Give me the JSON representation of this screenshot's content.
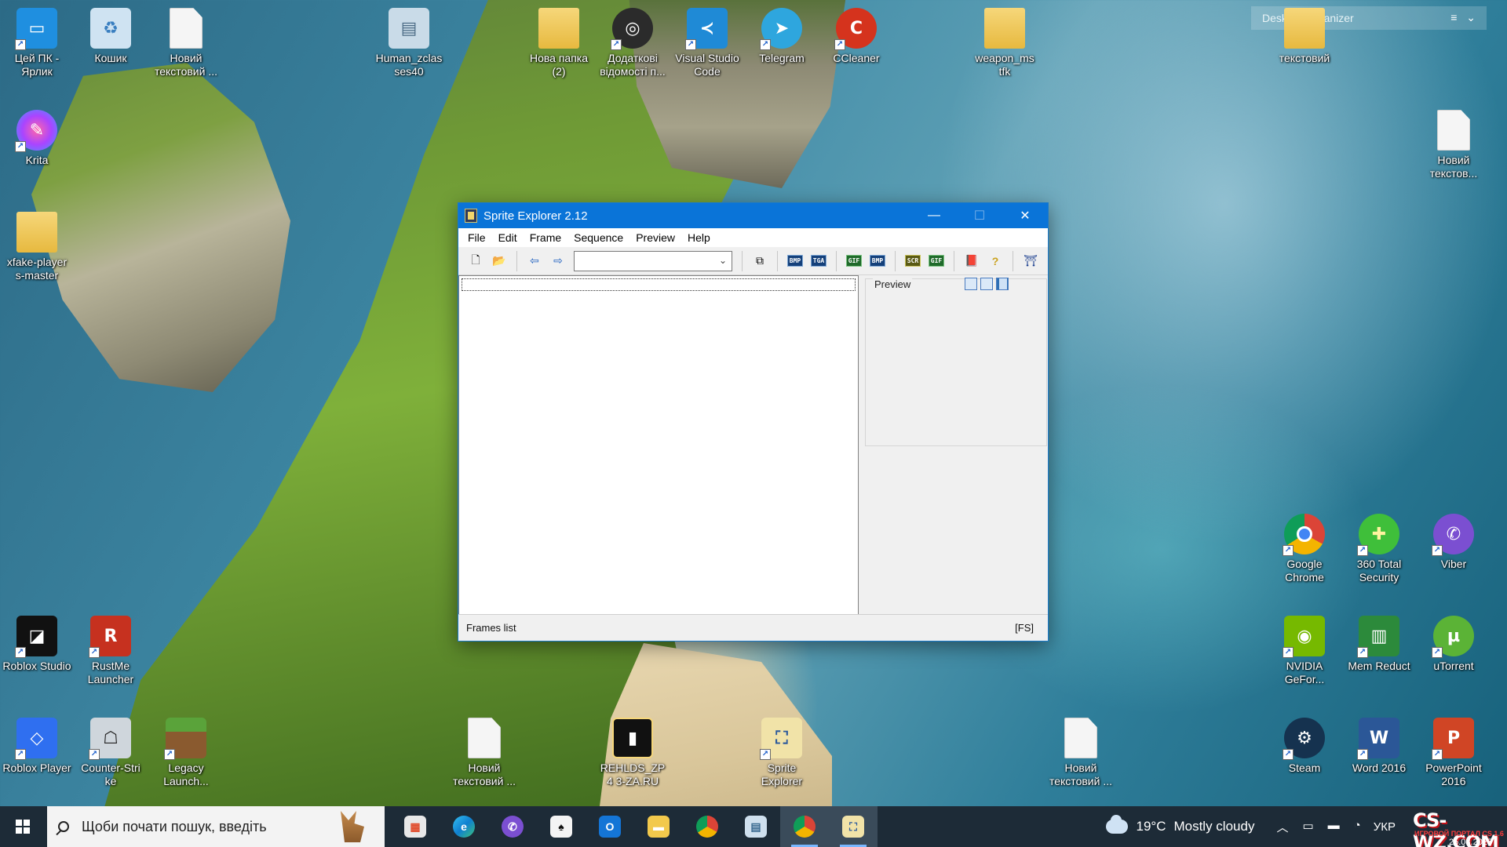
{
  "colors": {
    "titlebar": "#0a74d8",
    "taskbar": "#1d2b37",
    "window_bg": "#f0f0f0"
  },
  "desktop": {
    "organizer_title": "Desktop Organizer",
    "icons": [
      {
        "label": "Цей ПК - Ярлик",
        "icon": "this-pc-icon"
      },
      {
        "label": "Кошик",
        "icon": "recycle-bin-icon"
      },
      {
        "label": "Новий текстовий ...",
        "icon": "text-document-icon"
      },
      {
        "label": "Human_zclas ses40",
        "icon": "document-icon"
      },
      {
        "label": "Нова папка (2)",
        "icon": "folder-icon"
      },
      {
        "label": "Додаткові відомості п...",
        "icon": "info-icon"
      },
      {
        "label": "Visual Studio Code",
        "icon": "vscode-icon"
      },
      {
        "label": "Telegram",
        "icon": "telegram-icon"
      },
      {
        "label": "CCleaner",
        "icon": "ccleaner-icon"
      },
      {
        "label": "weapon_ms tfk",
        "icon": "folder-icon"
      },
      {
        "label": "текстовий",
        "icon": "folder-icon"
      },
      {
        "label": "Krita",
        "icon": "krita-icon"
      },
      {
        "label": "Новий текстов...",
        "icon": "text-document-icon"
      },
      {
        "label": "xfake-player s-master",
        "icon": "folder-icon"
      },
      {
        "label": "Google Chrome",
        "icon": "chrome-icon"
      },
      {
        "label": "360 Total Security",
        "icon": "360-security-icon"
      },
      {
        "label": "Viber",
        "icon": "viber-icon"
      },
      {
        "label": "Roblox Studio",
        "icon": "roblox-studio-icon"
      },
      {
        "label": "RustMe Launcher",
        "icon": "rustme-icon"
      },
      {
        "label": "NVIDIA GeFor...",
        "icon": "nvidia-icon"
      },
      {
        "label": "Mem Reduct",
        "icon": "mem-reduct-icon"
      },
      {
        "label": "uTorrent",
        "icon": "utorrent-icon"
      },
      {
        "label": "Roblox Player",
        "icon": "roblox-player-icon"
      },
      {
        "label": "Counter-Stri ke",
        "icon": "counter-strike-icon"
      },
      {
        "label": "Legacy Launch...",
        "icon": "minecraft-icon"
      },
      {
        "label": "Новий текстовий ...",
        "icon": "text-document-icon"
      },
      {
        "label": "REHLDS_ZP4 3-ZA.RU",
        "icon": "zip-folder-icon"
      },
      {
        "label": "Sprite Explorer",
        "icon": "sprite-explorer-icon"
      },
      {
        "label": "Новий текстовий ...",
        "icon": "text-document-icon"
      },
      {
        "label": "Steam",
        "icon": "steam-icon"
      },
      {
        "label": "Word 2016",
        "icon": "word-icon"
      },
      {
        "label": "PowerPoint 2016",
        "icon": "powerpoint-icon"
      }
    ]
  },
  "window": {
    "title": "Sprite Explorer 2.12",
    "controls": {
      "minimize": "—",
      "maximize": "☐",
      "close": "✕"
    },
    "menu": [
      "File",
      "Edit",
      "Frame",
      "Sequence",
      "Preview",
      "Help"
    ],
    "toolbar": {
      "combo_value": "",
      "badges": [
        "BMP",
        "TGA",
        "GIF",
        "BMP",
        "SCR",
        "GIF"
      ]
    },
    "preview_label": "Preview",
    "status_left": "Frames list",
    "status_right": "[FS]"
  },
  "taskbar": {
    "search_placeholder": "Щоби почати пошук, введіть",
    "apps": [
      "store",
      "edge",
      "viber",
      "solitaire",
      "outlook",
      "file-explorer",
      "chrome",
      "document",
      "chrome-profile",
      "sprite-explorer"
    ],
    "weather_temp": "19°C",
    "weather_text": "Mostly cloudy",
    "language": "УКР",
    "watermark": "CS-WZ.COM",
    "watermark_sub": "ИГРОВОЙ ПОРТАЛ CS 1.6",
    "date": "25.08.2025"
  }
}
